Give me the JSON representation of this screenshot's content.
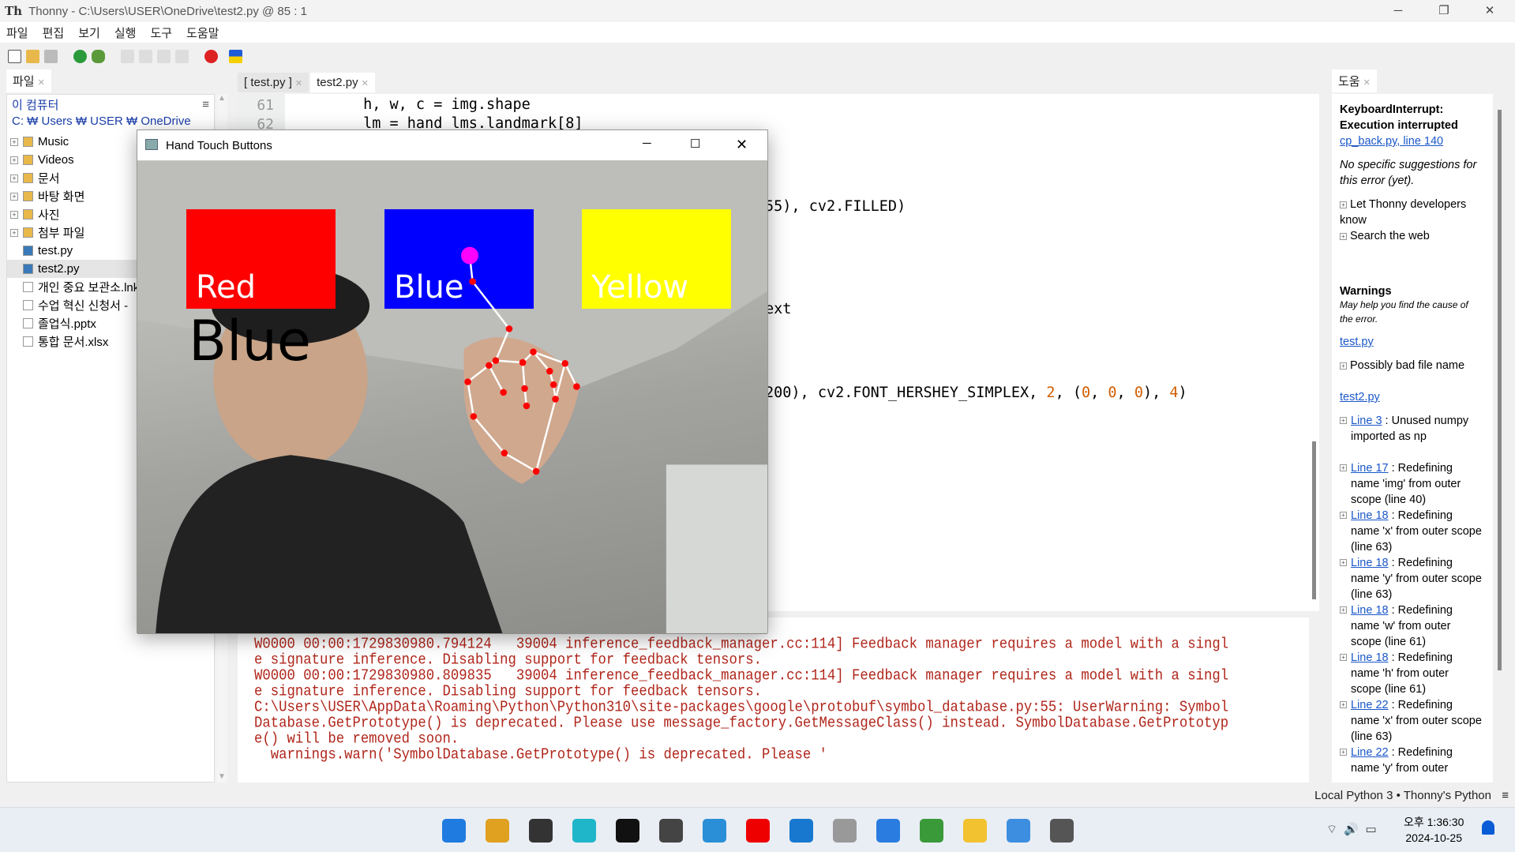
{
  "window": {
    "app": "Thonny",
    "title": "Thonny  -  C:\\Users\\USER\\OneDrive\\test2.py  @  85 : 1"
  },
  "menu": [
    "파일",
    "편집",
    "보기",
    "실행",
    "도구",
    "도움말"
  ],
  "files_panel": {
    "tab": "파일",
    "root": "이 컴퓨터",
    "path": "C: ₩ Users ₩ USER ₩ OneDrive",
    "items": [
      {
        "name": "Music",
        "type": "folder"
      },
      {
        "name": "Videos",
        "type": "folder"
      },
      {
        "name": "문서",
        "type": "folder"
      },
      {
        "name": "바탕 화면",
        "type": "folder"
      },
      {
        "name": "사진",
        "type": "folder"
      },
      {
        "name": "첨부 파일",
        "type": "folder"
      },
      {
        "name": "test.py",
        "type": "py"
      },
      {
        "name": "test2.py",
        "type": "py",
        "selected": true
      },
      {
        "name": "개인 중요 보관소.lnk",
        "type": "file"
      },
      {
        "name": "수업 혁신 신청서 -",
        "type": "file"
      },
      {
        "name": "졸업식.pptx",
        "type": "file"
      },
      {
        "name": "통합 문서.xlsx",
        "type": "file"
      }
    ]
  },
  "editor": {
    "tabs": [
      "[ test.py ]",
      "test2.py"
    ],
    "active_tab": "test2.py",
    "line_numbers": [
      "61",
      "62"
    ],
    "lines": [
      "        h, w, c = img.shape",
      "        lm = hand_lms.landmark[8]"
    ],
    "fragments": [
      "55), cv2.FILLED)",
      "ext",
      "200), cv2.FONT_HERSHEY_SIMPLEX, ",
      "2",
      ", (",
      "0",
      ", ",
      "0",
      ", ",
      "0",
      "), ",
      "4",
      ")"
    ]
  },
  "shell": {
    "lines": [
      "W0000 00:00:1729830980.794124   39004 inference_feedback_manager.cc:114] Feedback manager requires a model with a singl",
      "e signature inference. Disabling support for feedback tensors.",
      "W0000 00:00:1729830980.809835   39004 inference_feedback_manager.cc:114] Feedback manager requires a model with a singl",
      "e signature inference. Disabling support for feedback tensors.",
      "C:\\Users\\USER\\AppData\\Roaming\\Python\\Python310\\site-packages\\google\\protobuf\\symbol_database.py:55: UserWarning: Symbol",
      "Database.GetPrototype() is deprecated. Please use message_factory.GetMessageClass() instead. SymbolDatabase.GetPrototyp",
      "e() will be removed soon.",
      "  warnings.warn('SymbolDatabase.GetPrototype() is deprecated. Please '"
    ]
  },
  "help": {
    "tab": "도움",
    "error_title": "KeyboardInterrupt: Execution interrupted",
    "error_link": "cp_back.py, line 140",
    "no_suggestions": "No specific suggestions for this error (yet).",
    "actions": [
      "Let Thonny developers know",
      "Search the web"
    ],
    "warnings_title": "Warnings",
    "warnings_sub": "May help you find the cause of the error.",
    "file1": "test.py",
    "file1_items": [
      {
        "text": "Possibly bad file name"
      }
    ],
    "file2": "test2.py",
    "file2_items": [
      {
        "link": "Line 3",
        "text": " : Unused numpy imported as np"
      },
      {
        "link": "Line 17",
        "text": " : Redefining name 'img' from outer scope (line 40)"
      },
      {
        "link": "Line 18",
        "text": " : Redefining name 'x' from outer scope (line 63)"
      },
      {
        "link": "Line 18",
        "text": " : Redefining name 'y' from outer scope (line 63)"
      },
      {
        "link": "Line 18",
        "text": " : Redefining name 'w' from outer scope (line 61)"
      },
      {
        "link": "Line 18",
        "text": " : Redefining name 'h' from outer scope (line 61)"
      },
      {
        "link": "Line 22",
        "text": " : Redefining name 'x' from outer scope (line 63)"
      },
      {
        "link": "Line 22",
        "text": " : Redefining name 'y' from outer"
      }
    ]
  },
  "statusbar": {
    "interpreter": "Local Python 3  •  Thonny's Python"
  },
  "popup": {
    "title": "Hand Touch Buttons",
    "buttons": [
      {
        "label": "Red",
        "color": "#ff0000"
      },
      {
        "label": "Blue",
        "color": "#0000ff"
      },
      {
        "label": "Yellow",
        "color": "#ffff00"
      }
    ],
    "selected_text": "Blue",
    "landmark_tip_color": "#ff00ff",
    "landmark_color": "#ff0000"
  },
  "taskbar": {
    "time": "오후 1:36:30",
    "date": "2024-10-25"
  }
}
